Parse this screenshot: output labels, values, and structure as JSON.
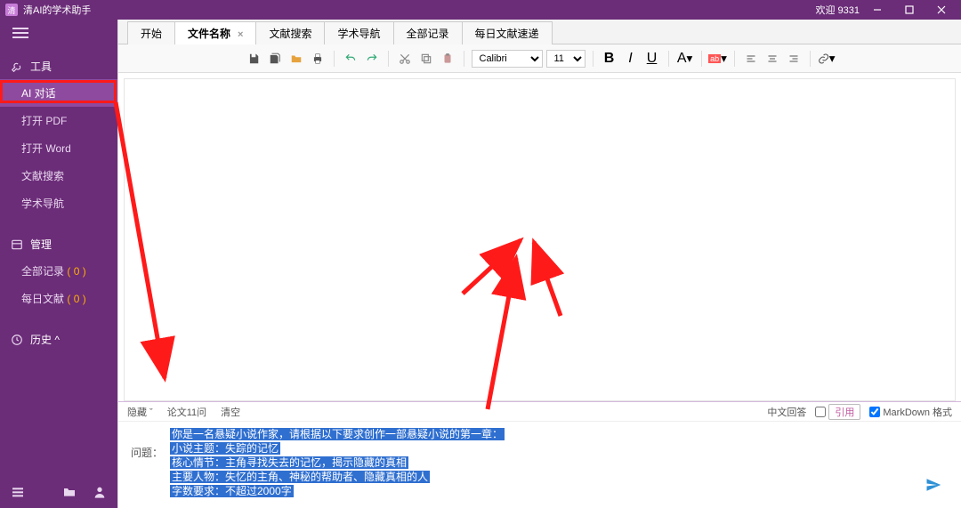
{
  "titlebar": {
    "app_name": "清AI的学术助手",
    "welcome": "欢迎 9331"
  },
  "sidebar": {
    "group_tools": "工具",
    "items_tools": [
      {
        "label": "AI 对话"
      },
      {
        "label": "打开 PDF"
      },
      {
        "label": "打开 Word"
      },
      {
        "label": "文献搜索"
      },
      {
        "label": "学术导航"
      }
    ],
    "group_manage": "管理",
    "items_manage": [
      {
        "label": "全部记录",
        "count": "( 0 )"
      },
      {
        "label": "每日文献",
        "count": "( 0 )"
      }
    ],
    "group_history": "历史 ^"
  },
  "tabs": [
    {
      "label": "开始"
    },
    {
      "label": "文件名称",
      "active": true,
      "closable": true
    },
    {
      "label": "文献搜索"
    },
    {
      "label": "学术导航"
    },
    {
      "label": "全部记录"
    },
    {
      "label": "每日文献速递"
    }
  ],
  "toolbar": {
    "font_name": "Calibri",
    "font_size": "11"
  },
  "bottom": {
    "hide": "隐藏 ˇ",
    "eleven": "论文11问",
    "clear": "清空",
    "cn_reply": "中文回答",
    "cite": "引用",
    "markdown": "MarkDown 格式",
    "question_label": "问题：",
    "prompt_lines": [
      "你是一名悬疑小说作家，请根据以下要求创作一部悬疑小说的第一章：",
      "小说主题：失踪的记忆",
      "核心情节：主角寻找失去的记忆，揭示隐藏的真相",
      "主要人物：失忆的主角、神秘的帮助者、隐藏真相的人",
      "字数要求：不超过2000字"
    ]
  }
}
